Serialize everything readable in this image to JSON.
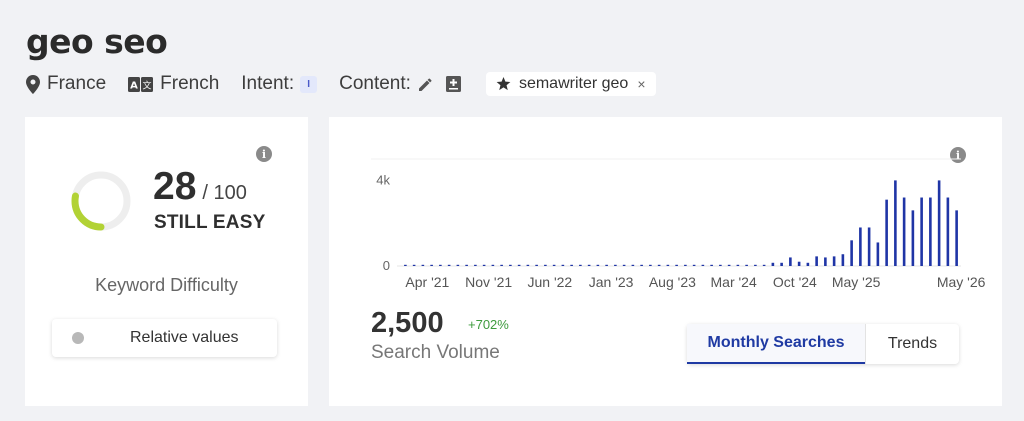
{
  "header": {
    "title": "geo seo",
    "location": "France",
    "language": "French",
    "intent_label": "Intent:",
    "intent_badge": "I",
    "content_label": "Content:",
    "tag_label": "semawriter geo",
    "tag_remove": "×"
  },
  "difficulty": {
    "score": "28",
    "max": "/ 100",
    "score_fraction": 0.28,
    "level": "STILL EASY",
    "caption": "Keyword Difficulty",
    "toggle_label": "Relative values",
    "ring_color": "#b2d235",
    "info": "i"
  },
  "volume": {
    "value": "2,500",
    "change": "+702%",
    "label": "Search Volume",
    "info": "i",
    "tabs": [
      {
        "label": "Monthly Searches",
        "active": true
      },
      {
        "label": "Trends",
        "active": false
      }
    ]
  },
  "chart_data": {
    "type": "bar",
    "bar_color": "#1f35a6",
    "y_tick_labels": [
      "0",
      "4k"
    ],
    "ylim": [
      0,
      5000
    ],
    "x_tick_labels": [
      "Apr '21",
      "Nov '21",
      "Jun '22",
      "Jan '23",
      "Aug '23",
      "Mar '24",
      "Oct '24",
      "May '25",
      "May '26"
    ],
    "x_tick_index": [
      0,
      7,
      14,
      21,
      28,
      35,
      42,
      49,
      61
    ],
    "values": [
      40,
      40,
      40,
      40,
      40,
      40,
      40,
      40,
      40,
      40,
      40,
      40,
      40,
      40,
      40,
      40,
      40,
      40,
      40,
      40,
      40,
      40,
      40,
      40,
      40,
      40,
      40,
      40,
      40,
      40,
      40,
      40,
      40,
      40,
      40,
      40,
      40,
      40,
      40,
      40,
      40,
      40,
      150,
      150,
      400,
      200,
      150,
      450,
      400,
      450,
      550,
      1200,
      1800,
      1800,
      1100,
      3100,
      4000,
      3200,
      2600,
      3200,
      3200,
      4000,
      3200,
      2600
    ]
  }
}
